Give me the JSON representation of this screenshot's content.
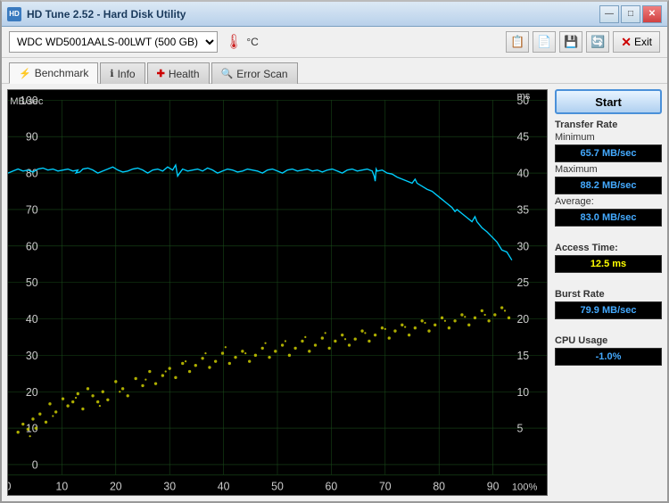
{
  "window": {
    "title": "HD Tune 2.52 - Hard Disk Utility",
    "icon": "HD"
  },
  "title_bar_buttons": {
    "minimize": "—",
    "maximize": "□",
    "close": "✕"
  },
  "toolbar": {
    "drive_value": "WDC  WD5001AALS-00LWT (500 GB)",
    "temp_label": "°C",
    "exit_label": "Exit"
  },
  "tabs": [
    {
      "id": "benchmark",
      "label": "Benchmark",
      "icon": "⚡",
      "active": true
    },
    {
      "id": "info",
      "label": "Info",
      "icon": "ℹ"
    },
    {
      "id": "health",
      "label": "Health",
      "icon": "+"
    },
    {
      "id": "errorscan",
      "label": "Error Scan",
      "icon": "🔍"
    }
  ],
  "chart": {
    "y_label_left": "MB/sec",
    "y_label_right": "ms",
    "x_label_right": "100%"
  },
  "sidebar": {
    "start_button": "Start",
    "transfer_rate_label": "Transfer Rate",
    "minimum_label": "Minimum",
    "minimum_value": "65.7 MB/sec",
    "maximum_label": "Maximum",
    "maximum_value": "88.2 MB/sec",
    "average_label": "Average:",
    "average_value": "83.0 MB/sec",
    "access_time_label": "Access Time:",
    "access_time_value": "12.5 ms",
    "burst_rate_label": "Burst Rate",
    "burst_rate_value": "79.9 MB/sec",
    "cpu_usage_label": "CPU Usage",
    "cpu_usage_value": "-1.0%"
  },
  "colors": {
    "accent": "#4499ff",
    "background": "#000000",
    "grid": "#1a4a1a",
    "transfer_line": "#00cfff",
    "scatter": "#cccc00"
  }
}
